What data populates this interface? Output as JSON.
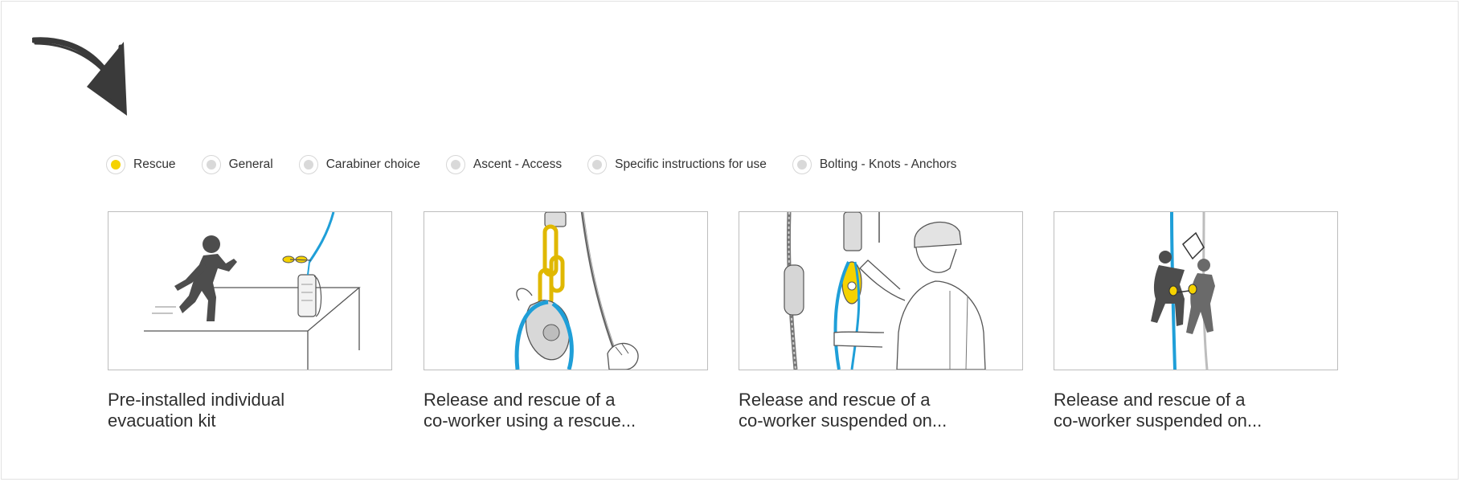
{
  "filters": [
    {
      "label": "Rescue",
      "selected": true
    },
    {
      "label": "General",
      "selected": false
    },
    {
      "label": "Carabiner choice",
      "selected": false
    },
    {
      "label": "Ascent - Access",
      "selected": false
    },
    {
      "label": "Specific instructions for use",
      "selected": false
    },
    {
      "label": "Bolting - Knots - Anchors",
      "selected": false
    }
  ],
  "cards": [
    {
      "line1": "Pre-installed individual",
      "line2": "evacuation kit",
      "illustration": "evacuation-kit-illustration"
    },
    {
      "line1": "Release and rescue of a",
      "line2": "co-worker using a rescue...",
      "illustration": "rescue-pulley-illustration"
    },
    {
      "line1": "Release and rescue of a",
      "line2": "co-worker suspended on...",
      "illustration": "worker-with-descender-illustration"
    },
    {
      "line1": "Release and rescue of a",
      "line2": "co-worker suspended on...",
      "illustration": "suspended-climbers-illustration"
    }
  ],
  "colors": {
    "accent": "#f5d200",
    "rope_blue": "#1f9fd8",
    "silhouette": "#4d4d4d",
    "text": "#333333",
    "border": "#bdbdbd"
  },
  "icons": {
    "arrow": "hand-drawn-arrow-icon",
    "radio_selected": "radio-selected-icon",
    "radio_unselected": "radio-unselected-icon"
  }
}
